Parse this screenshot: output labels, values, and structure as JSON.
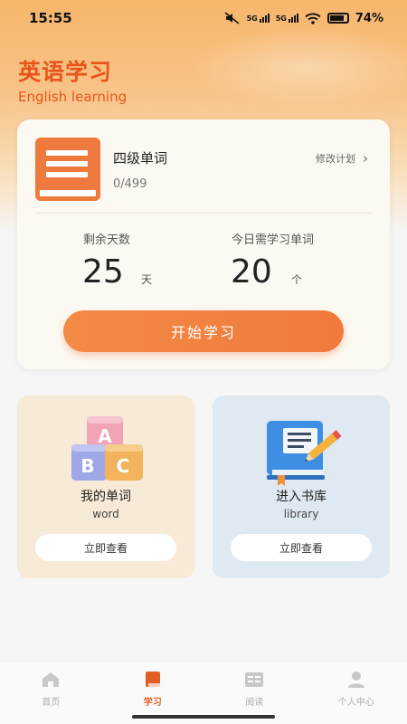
{
  "status_bar": {
    "time": "15:55",
    "signal_1": "5G",
    "signal_2": "5G",
    "battery": "74%"
  },
  "header": {
    "title": "英语学习",
    "subtitle": "English learning"
  },
  "plan": {
    "book_title": "四级单词",
    "progress": "0/499",
    "edit_label": "修改计划",
    "edit_chevron": "›",
    "remaining_days_label": "剩余天数",
    "remaining_days_value": "25",
    "remaining_days_unit": "天",
    "today_words_label": "今日需学习单词",
    "today_words_value": "20",
    "today_words_unit": "个",
    "start_button": "开始学习"
  },
  "features": {
    "word": {
      "title": "我的单词",
      "subtitle": "word",
      "button": "立即查看",
      "icon": "abc-blocks-icon",
      "blocks": [
        "A",
        "B",
        "C"
      ]
    },
    "library": {
      "title": "进入书库",
      "subtitle": "library",
      "button": "立即查看",
      "icon": "book-pencil-icon"
    }
  },
  "tabs": [
    {
      "label": "首页",
      "icon": "home-icon",
      "active": false
    },
    {
      "label": "学习",
      "icon": "book-icon",
      "active": true
    },
    {
      "label": "阅读",
      "icon": "reading-icon",
      "active": false
    },
    {
      "label": "个人中心",
      "icon": "user-icon",
      "active": false
    }
  ],
  "colors": {
    "accent": "#ef7a3c",
    "title": "#e8551c",
    "tab_active": "#e06024",
    "tab_inactive": "#c8c8c8"
  }
}
